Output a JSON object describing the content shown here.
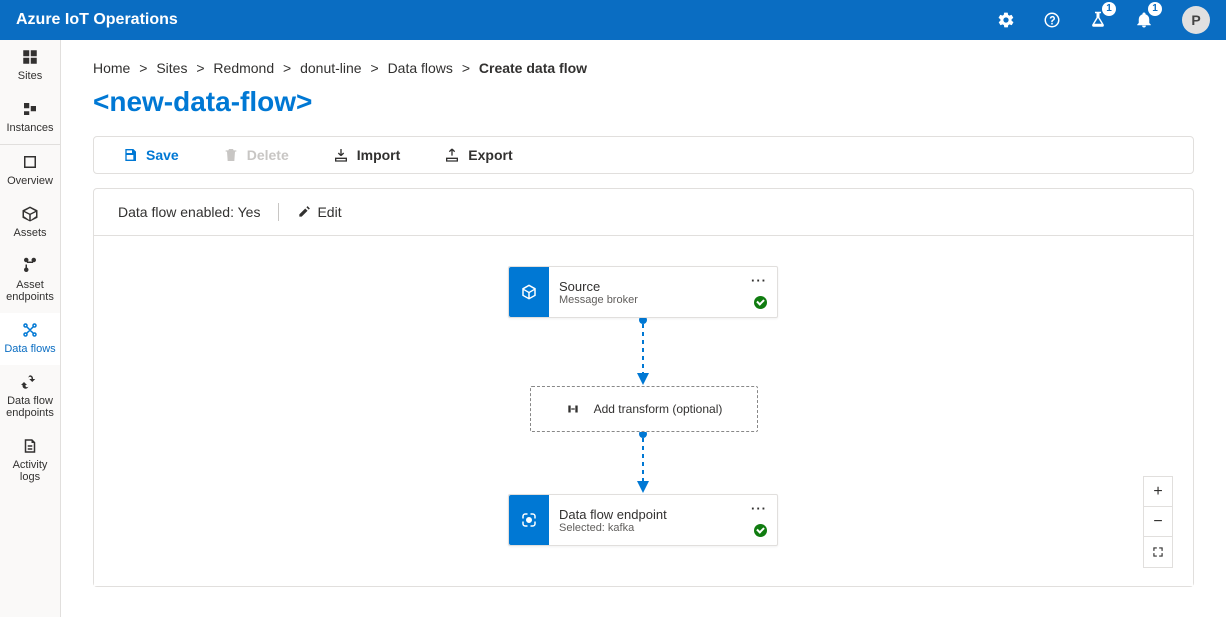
{
  "header": {
    "appTitle": "Azure IoT Operations",
    "notif1Badge": "1",
    "notif2Badge": "1",
    "avatarInitial": "P"
  },
  "sidebar": {
    "items": [
      {
        "label": "Sites"
      },
      {
        "label": "Instances"
      },
      {
        "label": "Overview"
      },
      {
        "label": "Assets"
      },
      {
        "label": "Asset endpoints"
      },
      {
        "label": "Data flows"
      },
      {
        "label": "Data flow endpoints"
      },
      {
        "label": "Activity logs"
      }
    ]
  },
  "breadcrumbs": {
    "home": "Home",
    "sites": "Sites",
    "redmond": "Redmond",
    "line": "donut-line",
    "section": "Data flows",
    "current": "Create data flow",
    "sep": ">"
  },
  "pageTitle": "<new-data-flow>",
  "toolbar": {
    "save": "Save",
    "delete": "Delete",
    "import": "Import",
    "export": "Export"
  },
  "status": {
    "label": "Data flow enabled:",
    "value": "Yes",
    "edit": "Edit"
  },
  "nodes": {
    "source": {
      "title": "Source",
      "subtitle": "Message broker"
    },
    "transform": {
      "label": "Add transform (optional)"
    },
    "dest": {
      "title": "Data flow endpoint",
      "subtitle": "Selected: kafka"
    }
  },
  "zoom": {
    "in": "+",
    "out": "−"
  }
}
